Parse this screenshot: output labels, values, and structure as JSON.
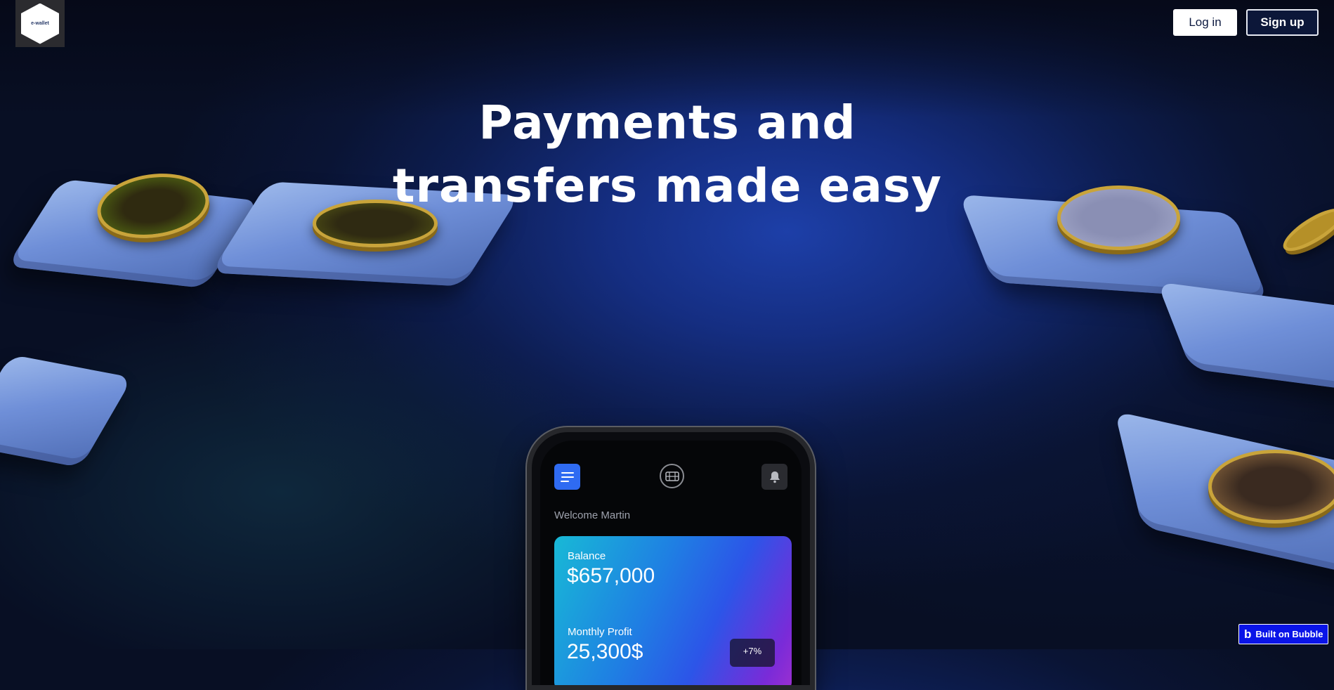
{
  "header": {
    "logo": {
      "text": "e-wallet",
      "icon": "hexagon-logo"
    },
    "login_label": "Log in",
    "signup_label": "Sign up"
  },
  "hero": {
    "title_line1": "Payments and",
    "title_line2": "transfers made easy"
  },
  "phone": {
    "icons": [
      "menu-icon",
      "card-chip-icon",
      "bell-icon"
    ],
    "welcome": "Welcome Martin",
    "card": {
      "balance_label": "Balance",
      "balance_value": "$657,000",
      "profit_label": "Monthly Profit",
      "profit_value": "25,300$",
      "profit_badge": "+7%"
    }
  },
  "badge": {
    "label": "Built on Bubble",
    "icon": "bubble-icon"
  },
  "colors": {
    "background": "#0d1d50",
    "accent_blue": "#2f6bf2",
    "badge_blue": "#0a14e8",
    "coin_gold": "#c9a43a"
  }
}
